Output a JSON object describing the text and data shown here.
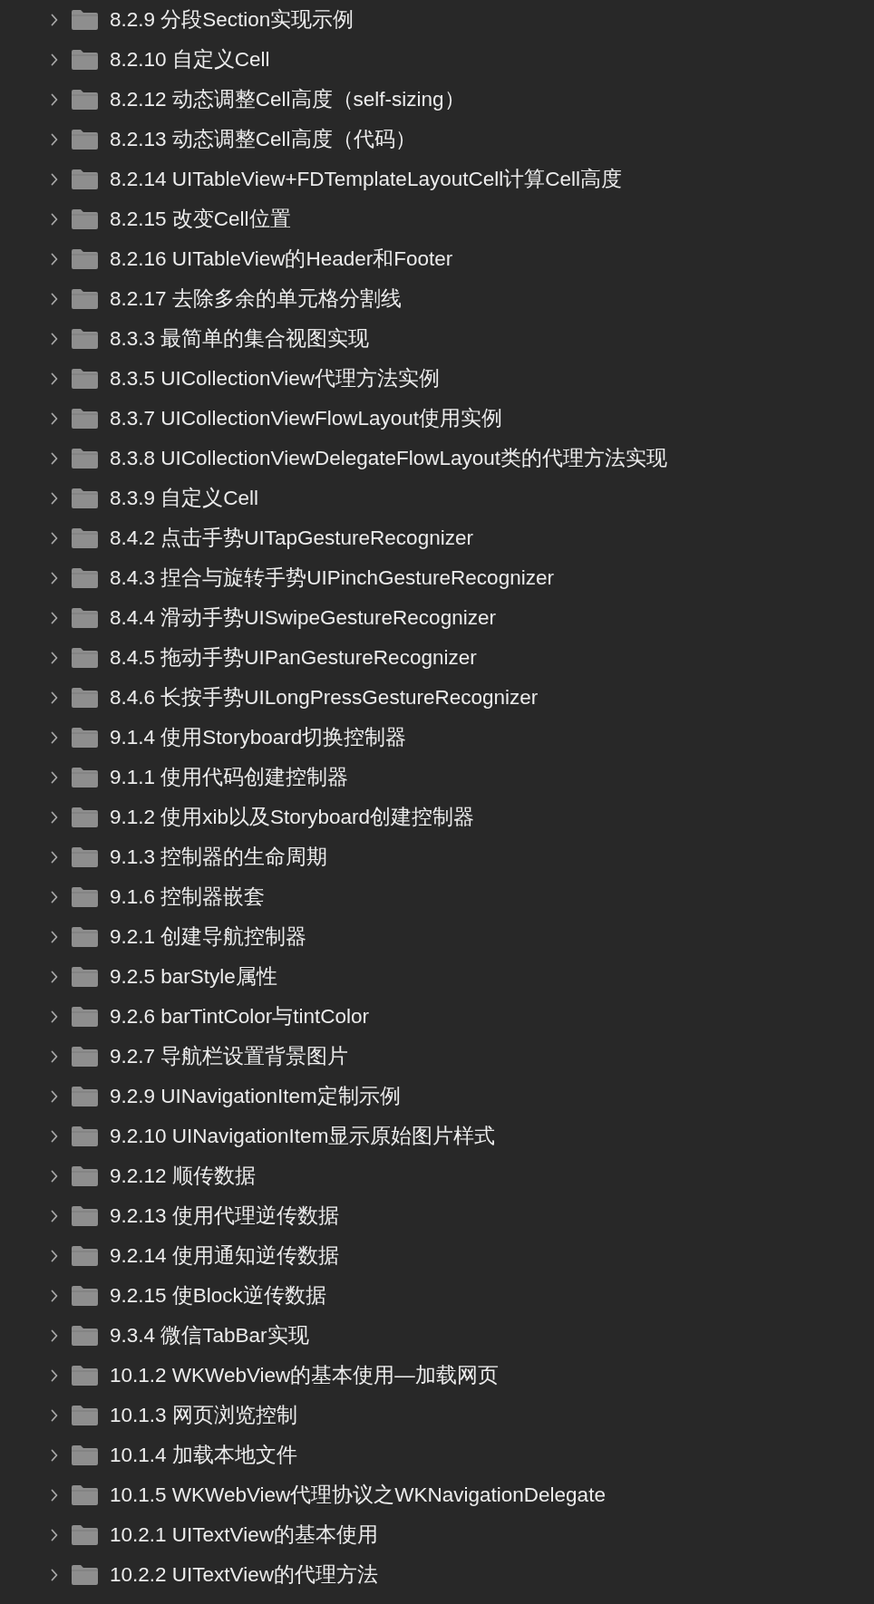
{
  "folders": [
    {
      "label": "8.2.9 分段Section实现示例",
      "expanded": false
    },
    {
      "label": "8.2.10 自定义Cell",
      "expanded": false
    },
    {
      "label": "8.2.12 动态调整Cell高度（self-sizing）",
      "expanded": false
    },
    {
      "label": "8.2.13 动态调整Cell高度（代码）",
      "expanded": false
    },
    {
      "label": "8.2.14 UITableView+FDTemplateLayoutCell计算Cell高度",
      "expanded": false
    },
    {
      "label": "8.2.15 改变Cell位置",
      "expanded": false
    },
    {
      "label": "8.2.16 UITableView的Header和Footer",
      "expanded": false
    },
    {
      "label": "8.2.17 去除多余的单元格分割线",
      "expanded": false
    },
    {
      "label": "8.3.3 最简单的集合视图实现",
      "expanded": false
    },
    {
      "label": "8.3.5 UICollectionView代理方法实例",
      "expanded": false
    },
    {
      "label": "8.3.7 UICollectionViewFlowLayout使用实例",
      "expanded": false
    },
    {
      "label": "8.3.8 UICollectionViewDelegateFlowLayout类的代理方法实现",
      "expanded": false
    },
    {
      "label": "8.3.9 自定义Cell",
      "expanded": false
    },
    {
      "label": "8.4.2 点击手势UITapGestureRecognizer",
      "expanded": false
    },
    {
      "label": "8.4.3 捏合与旋转手势UIPinchGestureRecognizer",
      "expanded": false
    },
    {
      "label": "8.4.4 滑动手势UISwipeGestureRecognizer",
      "expanded": false
    },
    {
      "label": "8.4.5 拖动手势UIPanGestureRecognizer",
      "expanded": false
    },
    {
      "label": "8.4.6 长按手势UILongPressGestureRecognizer",
      "expanded": false
    },
    {
      "label": "9.1.4 使用Storyboard切换控制器",
      "expanded": false
    },
    {
      "label": "9.1.1 使用代码创建控制器",
      "expanded": false
    },
    {
      "label": "9.1.2 使用xib以及Storyboard创建控制器",
      "expanded": false
    },
    {
      "label": "9.1.3 控制器的生命周期",
      "expanded": false
    },
    {
      "label": "9.1.6 控制器嵌套",
      "expanded": false
    },
    {
      "label": "9.2.1 创建导航控制器",
      "expanded": false
    },
    {
      "label": "9.2.5 barStyle属性",
      "expanded": false
    },
    {
      "label": "9.2.6 barTintColor与tintColor",
      "expanded": false
    },
    {
      "label": "9.2.7 导航栏设置背景图片",
      "expanded": false
    },
    {
      "label": "9.2.9 UINavigationItem定制示例",
      "expanded": false
    },
    {
      "label": "9.2.10 UINavigationItem显示原始图片样式",
      "expanded": false
    },
    {
      "label": "9.2.12 顺传数据",
      "expanded": false
    },
    {
      "label": "9.2.13 使用代理逆传数据",
      "expanded": false
    },
    {
      "label": "9.2.14 使用通知逆传数据",
      "expanded": false
    },
    {
      "label": "9.2.15 使Block逆传数据",
      "expanded": false
    },
    {
      "label": "9.3.4 微信TabBar实现",
      "expanded": false
    },
    {
      "label": "10.1.2 WKWebView的基本使用—加载网页",
      "expanded": false
    },
    {
      "label": "10.1.3 网页浏览控制",
      "expanded": false
    },
    {
      "label": "10.1.4 加载本地文件",
      "expanded": false
    },
    {
      "label": "10.1.5 WKWebView代理协议之WKNavigationDelegate",
      "expanded": false
    },
    {
      "label": "10.2.1 UITextView的基本使用",
      "expanded": false
    },
    {
      "label": "10.2.2 UITextView的代理方法",
      "expanded": false
    }
  ]
}
